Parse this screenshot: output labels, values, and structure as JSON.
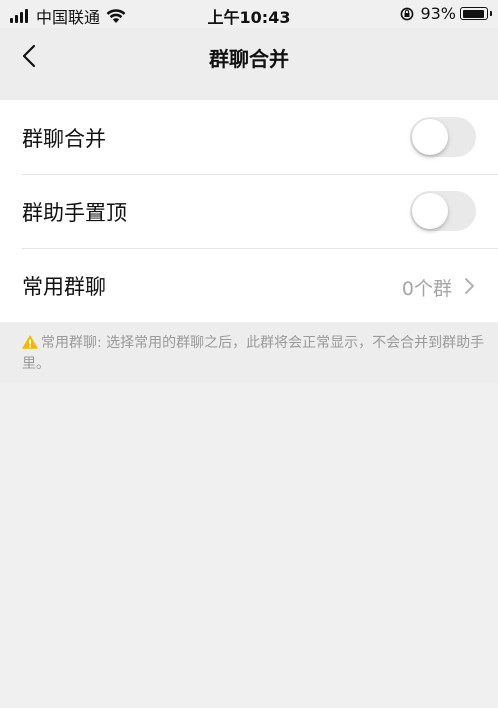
{
  "status_bar": {
    "carrier": "中国联通",
    "time": "上午10:43",
    "battery": "93%",
    "icons": [
      "signal-icon",
      "wifi-icon",
      "rotation-lock-icon",
      "battery-icon"
    ]
  },
  "nav": {
    "title": "群聊合并",
    "back_icon": "chevron-left-icon"
  },
  "settings": {
    "items": [
      {
        "label": "群聊合并",
        "type": "toggle",
        "on": false
      },
      {
        "label": "群助手置顶",
        "type": "toggle",
        "on": false
      },
      {
        "label": "常用群聊",
        "type": "link",
        "value": "0个群"
      }
    ]
  },
  "tip": {
    "icon": "warning-icon",
    "text": "常用群聊: 选择常用的群聊之后，此群将会正常显示，不会合并到群助手里。"
  },
  "colors": {
    "background": "#f0f0f0",
    "toggle_off": "#e9e9e9",
    "secondary_text": "#a6a6a6",
    "warning": "#f5b800"
  }
}
